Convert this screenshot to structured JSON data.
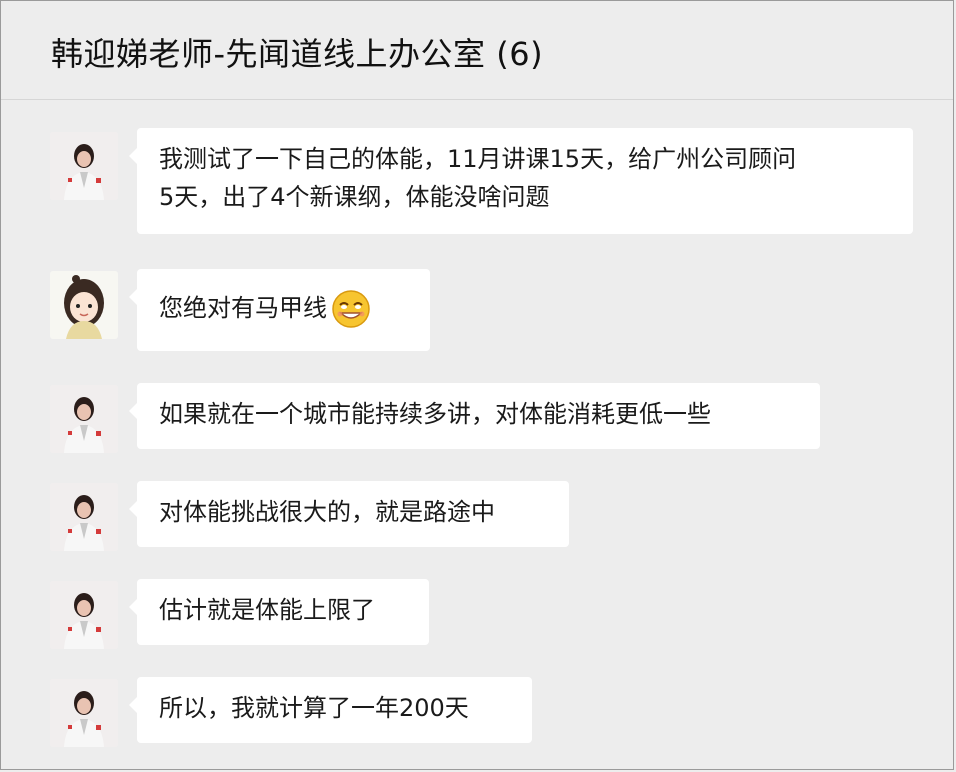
{
  "chat": {
    "title": "韩迎娣老师-先闻道线上办公室 (6)"
  },
  "messages": [
    {
      "sender": "teacher",
      "lines": [
        "我测试了一下自己的体能，11月讲课15天，给广州公司顾问",
        "5天，出了4个新课纲，体能没啥问题"
      ]
    },
    {
      "sender": "girl",
      "lines": [
        "您绝对有马甲线"
      ],
      "emoji": "grin-emoji"
    },
    {
      "sender": "teacher",
      "lines": [
        "如果就在一个城市能持续多讲，对体能消耗更低一些"
      ]
    },
    {
      "sender": "teacher",
      "lines": [
        "对体能挑战很大的，就是路途中"
      ]
    },
    {
      "sender": "teacher",
      "lines": [
        "估计就是体能上限了"
      ]
    },
    {
      "sender": "teacher",
      "lines": [
        "所以，我就计算了一年200天"
      ]
    }
  ],
  "colors": {
    "background": "#ededed",
    "bubble": "#ffffff",
    "text": "#1a1a1a"
  }
}
